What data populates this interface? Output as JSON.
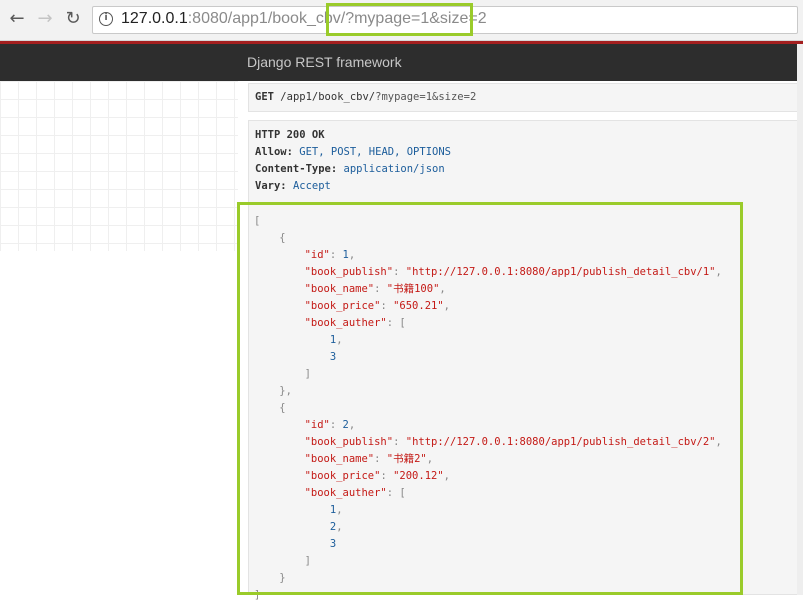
{
  "browser": {
    "url_host": "127.0.0.1",
    "url_rest": ":8080/app1/book_cbv/?mypage=1&size=2",
    "back_icon": "←",
    "forward_icon": "→",
    "reload_icon": "↻",
    "info_icon": "i"
  },
  "navbar": {
    "brand": "Django REST framework"
  },
  "request": {
    "method": "GET",
    "path": "/app1/book_cbv/",
    "query": "?mypage=1&size=2"
  },
  "response": {
    "status": "HTTP 200 OK",
    "headers": [
      {
        "name": "Allow:",
        "value": "GET, POST, HEAD, OPTIONS"
      },
      {
        "name": "Content-Type:",
        "value": "application/json"
      },
      {
        "name": "Vary:",
        "value": "Accept"
      }
    ]
  },
  "json_lines": [
    [
      [
        "p",
        "["
      ]
    ],
    [
      [
        "p",
        "    {"
      ]
    ],
    [
      [
        "p",
        "        "
      ],
      [
        "k",
        "\"id\""
      ],
      [
        "p",
        ": "
      ],
      [
        "n",
        "1"
      ],
      [
        "p",
        ","
      ]
    ],
    [
      [
        "p",
        "        "
      ],
      [
        "k",
        "\"book_publish\""
      ],
      [
        "p",
        ": "
      ],
      [
        "s",
        "\"http://127.0.0.1:8080/app1/publish_detail_cbv/1\""
      ],
      [
        "p",
        ","
      ]
    ],
    [
      [
        "p",
        "        "
      ],
      [
        "k",
        "\"book_name\""
      ],
      [
        "p",
        ": "
      ],
      [
        "s",
        "\"书籍100\""
      ],
      [
        "p",
        ","
      ]
    ],
    [
      [
        "p",
        "        "
      ],
      [
        "k",
        "\"book_price\""
      ],
      [
        "p",
        ": "
      ],
      [
        "s",
        "\"650.21\""
      ],
      [
        "p",
        ","
      ]
    ],
    [
      [
        "p",
        "        "
      ],
      [
        "k",
        "\"book_auther\""
      ],
      [
        "p",
        ": ["
      ]
    ],
    [
      [
        "p",
        "            "
      ],
      [
        "n",
        "1"
      ],
      [
        "p",
        ","
      ]
    ],
    [
      [
        "p",
        "            "
      ],
      [
        "n",
        "3"
      ]
    ],
    [
      [
        "p",
        "        ]"
      ]
    ],
    [
      [
        "p",
        "    },"
      ]
    ],
    [
      [
        "p",
        "    {"
      ]
    ],
    [
      [
        "p",
        "        "
      ],
      [
        "k",
        "\"id\""
      ],
      [
        "p",
        ": "
      ],
      [
        "n",
        "2"
      ],
      [
        "p",
        ","
      ]
    ],
    [
      [
        "p",
        "        "
      ],
      [
        "k",
        "\"book_publish\""
      ],
      [
        "p",
        ": "
      ],
      [
        "s",
        "\"http://127.0.0.1:8080/app1/publish_detail_cbv/2\""
      ],
      [
        "p",
        ","
      ]
    ],
    [
      [
        "p",
        "        "
      ],
      [
        "k",
        "\"book_name\""
      ],
      [
        "p",
        ": "
      ],
      [
        "s",
        "\"书籍2\""
      ],
      [
        "p",
        ","
      ]
    ],
    [
      [
        "p",
        "        "
      ],
      [
        "k",
        "\"book_price\""
      ],
      [
        "p",
        ": "
      ],
      [
        "s",
        "\"200.12\""
      ],
      [
        "p",
        ","
      ]
    ],
    [
      [
        "p",
        "        "
      ],
      [
        "k",
        "\"book_auther\""
      ],
      [
        "p",
        ": ["
      ]
    ],
    [
      [
        "p",
        "            "
      ],
      [
        "n",
        "1"
      ],
      [
        "p",
        ","
      ]
    ],
    [
      [
        "p",
        "            "
      ],
      [
        "n",
        "2"
      ],
      [
        "p",
        ","
      ]
    ],
    [
      [
        "p",
        "            "
      ],
      [
        "n",
        "3"
      ]
    ],
    [
      [
        "p",
        "        ]"
      ]
    ],
    [
      [
        "p",
        "    }"
      ]
    ],
    [
      [
        "p",
        "]"
      ]
    ]
  ],
  "colors": {
    "highlight": "#9acb2a",
    "navbar": "#2d2d2d",
    "accent_red": "#a31f1f",
    "json_key": "#c41a16",
    "json_number": "#1c5d9b"
  }
}
